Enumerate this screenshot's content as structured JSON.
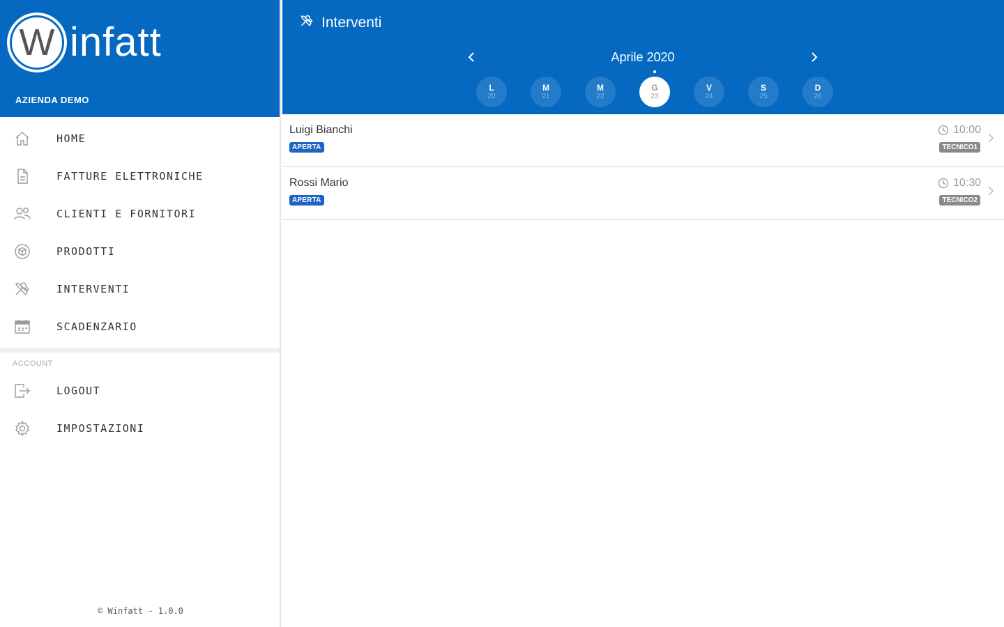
{
  "brand": {
    "logo_letter": "W",
    "logo_text": "infatt",
    "company": "AZIENDA DEMO"
  },
  "sidebar": {
    "items": [
      {
        "label": "HOME",
        "icon": "home-icon"
      },
      {
        "label": "FATTURE ELETTRONICHE",
        "icon": "document-icon"
      },
      {
        "label": "CLIENTI E FORNITORI",
        "icon": "users-icon"
      },
      {
        "label": "PRODOTTI",
        "icon": "box-icon"
      },
      {
        "label": "INTERVENTI",
        "icon": "tools-icon"
      },
      {
        "label": "SCADENZARIO",
        "icon": "calendar-icon"
      }
    ],
    "account_label": "ACCOUNT",
    "account_items": [
      {
        "label": "LOGOUT",
        "icon": "logout-icon"
      },
      {
        "label": "IMPOSTAZIONI",
        "icon": "gear-icon"
      }
    ],
    "footer": "© Winfatt - 1.0.0"
  },
  "header": {
    "title": "Interventi",
    "icon": "tools-icon",
    "month": "Aprile 2020",
    "days": [
      {
        "letter": "L",
        "num": "20"
      },
      {
        "letter": "M",
        "num": "21"
      },
      {
        "letter": "M",
        "num": "22"
      },
      {
        "letter": "G",
        "num": "23"
      },
      {
        "letter": "V",
        "num": "24"
      },
      {
        "letter": "S",
        "num": "25"
      },
      {
        "letter": "D",
        "num": "26"
      }
    ],
    "selected_day": "23"
  },
  "interventions": [
    {
      "name": "Luigi Bianchi",
      "status": "APERTA",
      "time": "10:00",
      "tech": "TECNICO1"
    },
    {
      "name": "Rossi Mario",
      "status": "APERTA",
      "time": "10:30",
      "tech": "TECNICO2"
    }
  ],
  "colors": {
    "primary": "#0569c2",
    "badge": "#1f63c5",
    "tech_badge": "#8a8a8a"
  }
}
